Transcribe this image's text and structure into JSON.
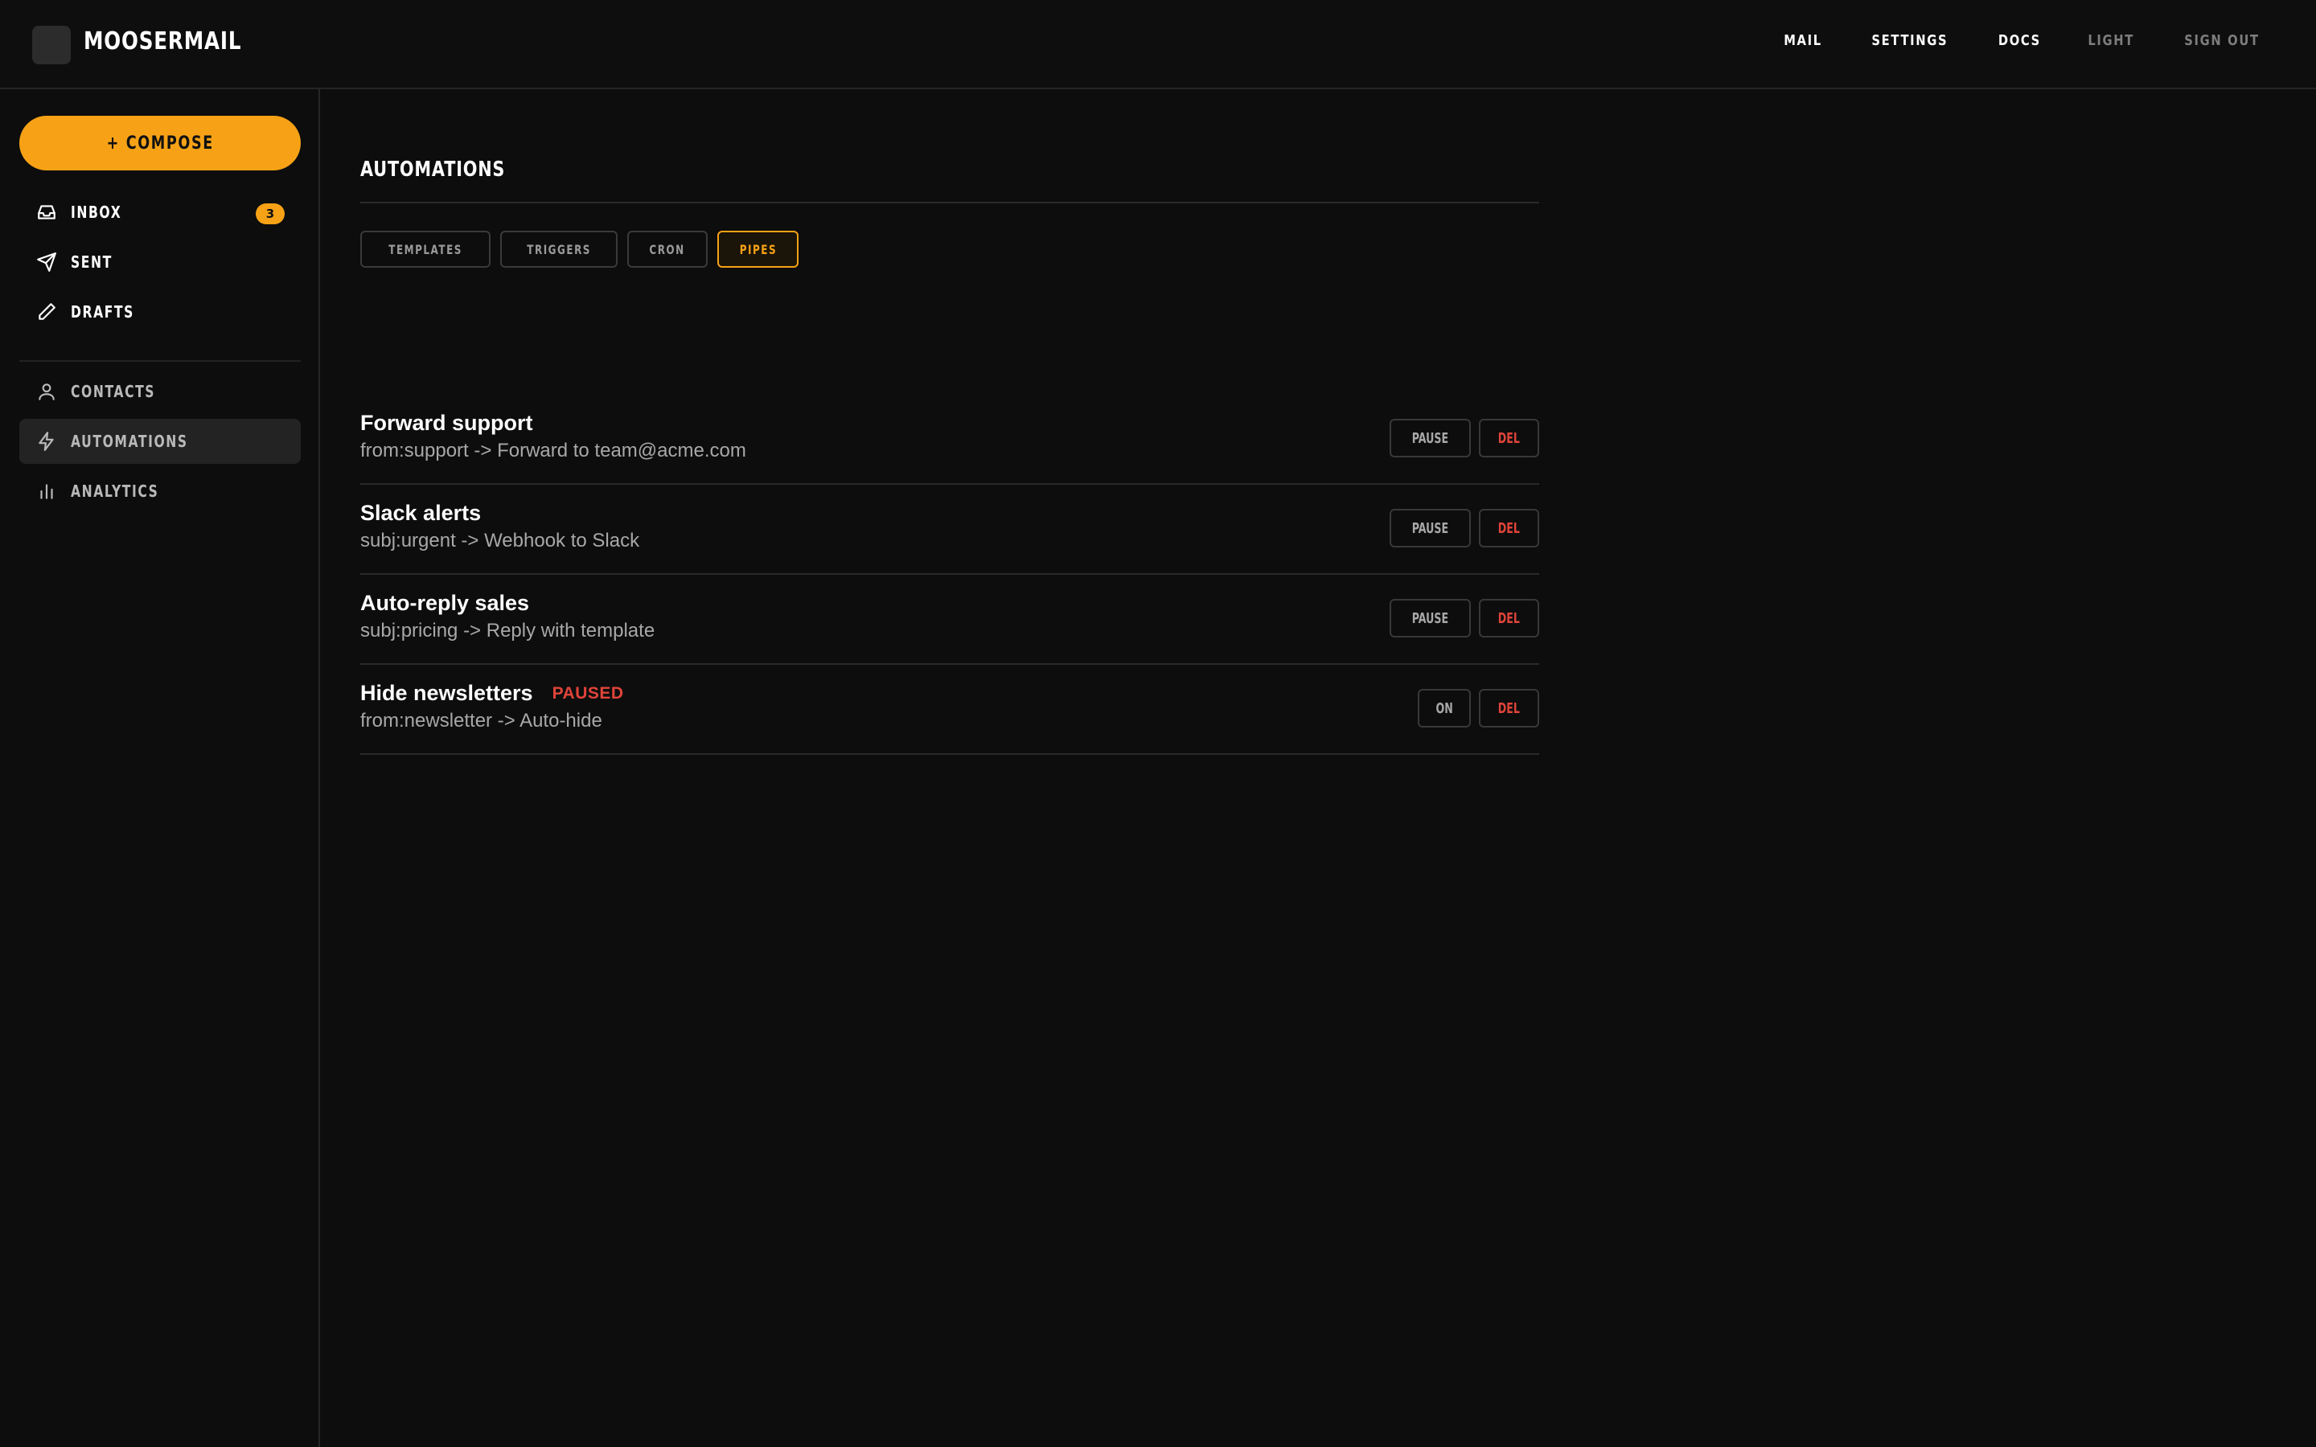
{
  "app": {
    "name": "MOOSERMAIL"
  },
  "topnav": {
    "items": [
      {
        "label": "MAIL"
      },
      {
        "label": "SETTINGS"
      },
      {
        "label": "DOCS"
      },
      {
        "label": "LIGHT"
      },
      {
        "label": "SIGN OUT"
      }
    ]
  },
  "sidebar": {
    "compose_label": "+ COMPOSE",
    "items": [
      {
        "label": "INBOX",
        "icon": "inbox-icon",
        "badge": "3"
      },
      {
        "label": "SENT",
        "icon": "send-icon"
      },
      {
        "label": "DRAFTS",
        "icon": "pencil-icon"
      },
      {
        "label": "CONTACTS",
        "icon": "user-icon"
      },
      {
        "label": "AUTOMATIONS",
        "icon": "bolt-icon",
        "active": true
      },
      {
        "label": "ANALYTICS",
        "icon": "bar-chart-icon"
      }
    ]
  },
  "main": {
    "title": "AUTOMATIONS",
    "tabs": [
      {
        "label": "TEMPLATES"
      },
      {
        "label": "TRIGGERS"
      },
      {
        "label": "CRON"
      },
      {
        "label": "PIPES",
        "active": true
      }
    ],
    "rules": [
      {
        "name": "Forward support",
        "description": "from:support -> Forward to team@acme.com",
        "toggle_label": "PAUSE",
        "delete_label": "DEL"
      },
      {
        "name": "Slack alerts",
        "description": "subj:urgent -> Webhook to Slack",
        "toggle_label": "PAUSE",
        "delete_label": "DEL"
      },
      {
        "name": "Auto-reply sales",
        "description": "subj:pricing -> Reply with template",
        "toggle_label": "PAUSE",
        "delete_label": "DEL"
      },
      {
        "name": "Hide newsletters",
        "status": "PAUSED",
        "description": "from:newsletter -> Auto-hide",
        "toggle_label": "ON",
        "delete_label": "DEL"
      }
    ]
  },
  "colors": {
    "accent": "#f7a216",
    "danger": "#e0443a",
    "background": "#0d0d0d"
  }
}
